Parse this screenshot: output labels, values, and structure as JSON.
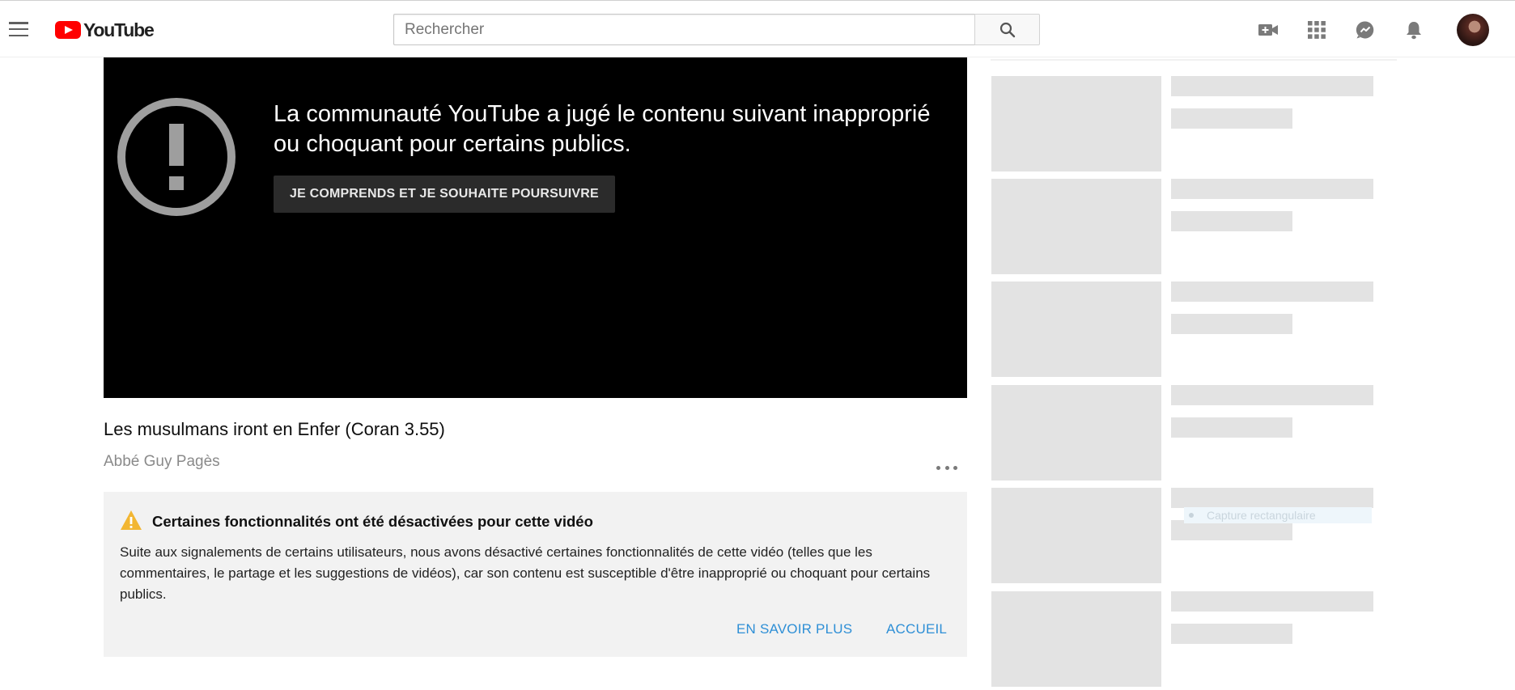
{
  "header": {
    "logo_text": "YouTube",
    "search_placeholder": "Rechercher",
    "icons": [
      "menu-icon",
      "search-icon",
      "video-camera-icon",
      "apps-icon",
      "messages-icon",
      "bell-icon"
    ]
  },
  "player": {
    "warning_message": "La communauté YouTube a jugé le contenu suivant inapproprié ou choquant pour certains publics.",
    "proceed_label": "JE COMPRENDS ET JE SOUHAITE POURSUIVRE"
  },
  "video": {
    "title": "Les musulmans iront en Enfer (Coran 3.55)",
    "channel": "Abbé Guy Pagès"
  },
  "notice": {
    "title": "Certaines fonctionnalités ont été désactivées pour cette vidéo",
    "body": "Suite aux signalements de certains utilisateurs, nous avons désactivé certaines fonctionnalités de cette vidéo (telles que les commentaires, le partage et les suggestions de vidéos), car son contenu est susceptible d'être inapproprié ou choquant pour certains publics.",
    "learn_more_label": "EN SAVOIR PLUS",
    "home_label": "ACCUEIL"
  },
  "sidebar": {
    "ghost_overlay_text": "Capture rectangulaire"
  },
  "colors": {
    "brand_red": "#ff0000",
    "link_blue": "#2e8fd6",
    "warning_yellow": "#f2b632",
    "skeleton_gray": "#e3e3e3"
  }
}
